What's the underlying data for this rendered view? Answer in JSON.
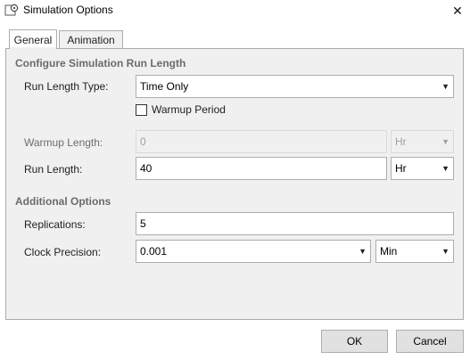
{
  "window": {
    "title": "Simulation Options",
    "close_glyph": "✕",
    "icon": "gear-icon"
  },
  "tabs": [
    {
      "label": "General",
      "active": true
    },
    {
      "label": "Animation",
      "active": false
    }
  ],
  "run_length_section": {
    "heading": "Configure Simulation Run Length",
    "run_length_type": {
      "label": "Run Length Type:",
      "value": "Time Only"
    },
    "warmup_checkbox": {
      "label": "Warmup Period",
      "checked": false
    },
    "warmup_length": {
      "label": "Warmup Length:",
      "value": "0",
      "unit": "Hr",
      "enabled": false
    },
    "run_length": {
      "label": "Run Length:",
      "value": "40",
      "unit": "Hr"
    }
  },
  "additional_section": {
    "heading": "Additional Options",
    "replications": {
      "label": "Replications:",
      "value": "5"
    },
    "clock_precision": {
      "label": "Clock Precision:",
      "value": "0.001",
      "unit": "Min"
    }
  },
  "buttons": {
    "ok": "OK",
    "cancel": "Cancel"
  },
  "dropdown_arrow": "▼"
}
